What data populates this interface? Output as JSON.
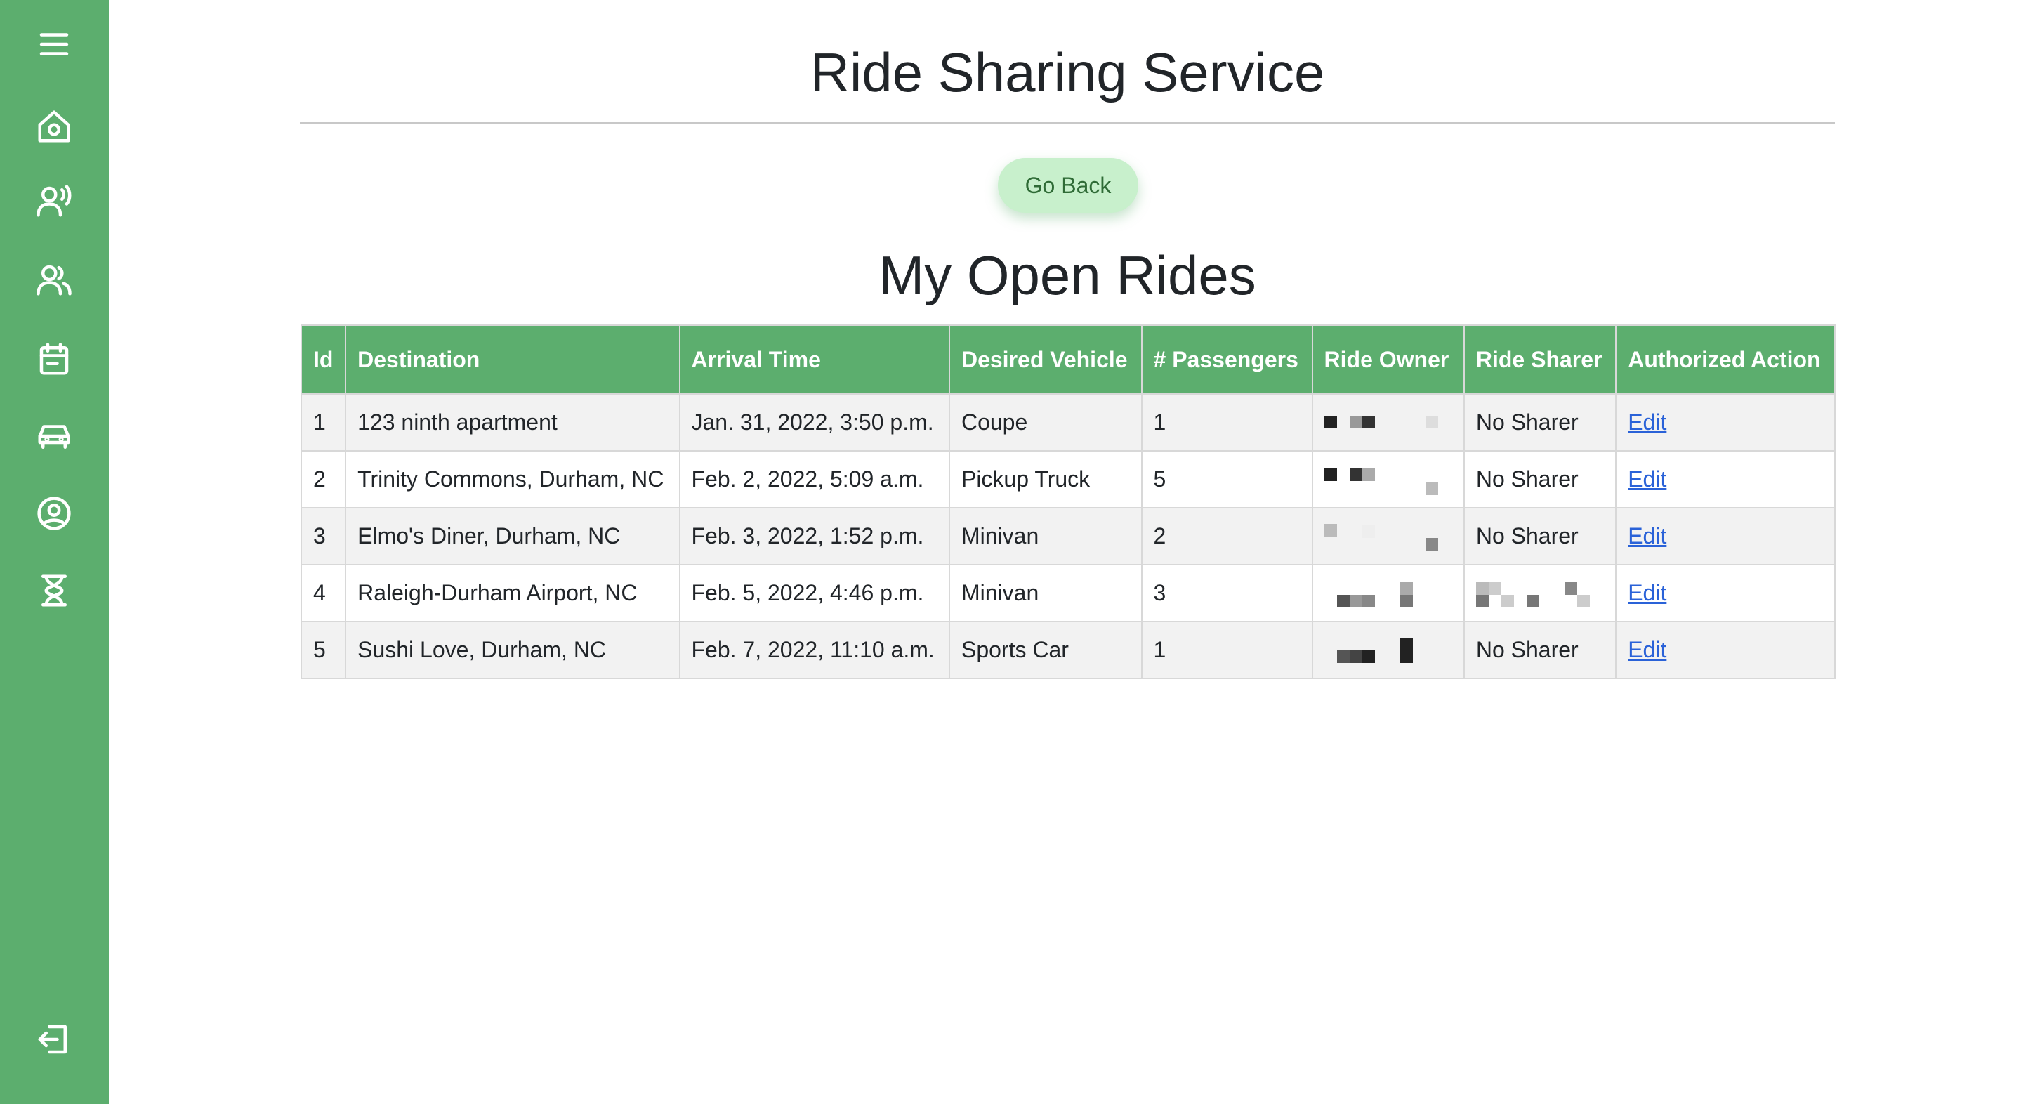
{
  "sidebar": {
    "accent_color": "#5cae6e",
    "icons": [
      "menu-icon",
      "home-icon",
      "ride-requests-icon",
      "users-icon",
      "calendar-icon",
      "car-icon",
      "profile-icon",
      "hourglass-icon",
      "logout-icon"
    ]
  },
  "header": {
    "title": "Ride Sharing Service"
  },
  "actions": {
    "go_back_label": "Go Back"
  },
  "rides": {
    "title": "My Open Rides",
    "columns": [
      "Id",
      "Destination",
      "Arrival Time",
      "Desired Vehicle",
      "# Passengers",
      "Ride Owner",
      "Ride Sharer",
      "Authorized Action"
    ],
    "rows": [
      {
        "id": "1",
        "destination": "123 ninth apartment",
        "arrival": "Jan. 31, 2022, 3:50 p.m.",
        "vehicle": "Coupe",
        "passengers": "1",
        "owner": "",
        "sharer": "No Sharer",
        "action": "Edit"
      },
      {
        "id": "2",
        "destination": "Trinity Commons, Durham, NC",
        "arrival": "Feb. 2, 2022, 5:09 a.m.",
        "vehicle": "Pickup Truck",
        "passengers": "5",
        "owner": "",
        "sharer": "No Sharer",
        "action": "Edit"
      },
      {
        "id": "3",
        "destination": "Elmo's Diner, Durham, NC",
        "arrival": "Feb. 3, 2022, 1:52 p.m.",
        "vehicle": "Minivan",
        "passengers": "2",
        "owner": "",
        "sharer": "No Sharer",
        "action": "Edit"
      },
      {
        "id": "4",
        "destination": "Raleigh-Durham Airport, NC",
        "arrival": "Feb. 5, 2022, 4:46 p.m.",
        "vehicle": "Minivan",
        "passengers": "3",
        "owner": "",
        "sharer": "",
        "action": "Edit"
      },
      {
        "id": "5",
        "destination": "Sushi Love, Durham, NC",
        "arrival": "Feb. 7, 2022, 11:10 a.m.",
        "vehicle": "Sports Car",
        "passengers": "1",
        "owner": "",
        "sharer": "No Sharer",
        "action": "Edit"
      }
    ]
  }
}
